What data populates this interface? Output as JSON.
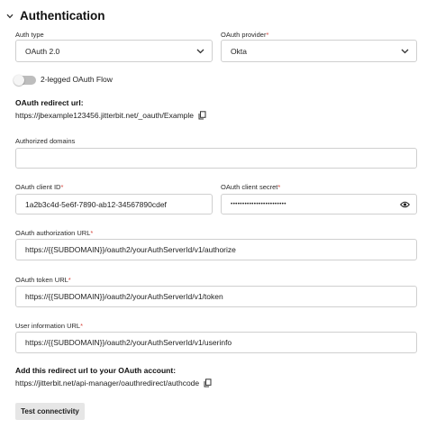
{
  "section": {
    "title": "Authentication"
  },
  "auth_type": {
    "label": "Auth type",
    "value": "OAuth 2.0"
  },
  "oauth_provider": {
    "label": "OAuth provider",
    "required_mark": "*",
    "value": "Okta"
  },
  "two_legged": {
    "label": "2-legged OAuth Flow",
    "enabled": false
  },
  "redirect": {
    "label": "OAuth redirect url:",
    "url": "https://jbexample123456.jitterbit.net/_oauth/Example"
  },
  "authorized_domains": {
    "label": "Authorized domains",
    "value": ""
  },
  "client_id": {
    "label": "OAuth client ID",
    "required_mark": "*",
    "value": "1a2b3c4d-5e6f-7890-ab12-34567890cdef"
  },
  "client_secret": {
    "label": "OAuth client secret",
    "required_mark": "*",
    "value": "••••••••••••••••••••••••"
  },
  "authorization_url": {
    "label": "OAuth authorization URL",
    "required_mark": "*",
    "value": "https://{{SUBDOMAIN}}/oauth2/yourAuthServerId/v1/authorize"
  },
  "token_url": {
    "label": "OAuth token URL",
    "required_mark": "*",
    "value": "https://{{SUBDOMAIN}}/oauth2/yourAuthServerId/v1/token"
  },
  "userinfo_url": {
    "label": "User information URL",
    "required_mark": "*",
    "value": "https://{{SUBDOMAIN}}/oauth2/yourAuthServerId/v1/userinfo"
  },
  "account_redirect": {
    "label": "Add this redirect url to your OAuth account:",
    "url": "https://jitterbit.net/api-manager/oauthredirect/authcode"
  },
  "test_button": {
    "label": "Test connectivity"
  },
  "colors": {
    "required": "#d6443b",
    "button_bg": "#e6e6e6",
    "border": "#cfcfcf",
    "toggle_off": "#bdbdbd"
  },
  "icons": [
    "chevron-down-icon",
    "dropdown-arrow-icon",
    "copy-icon",
    "eye-icon"
  ]
}
